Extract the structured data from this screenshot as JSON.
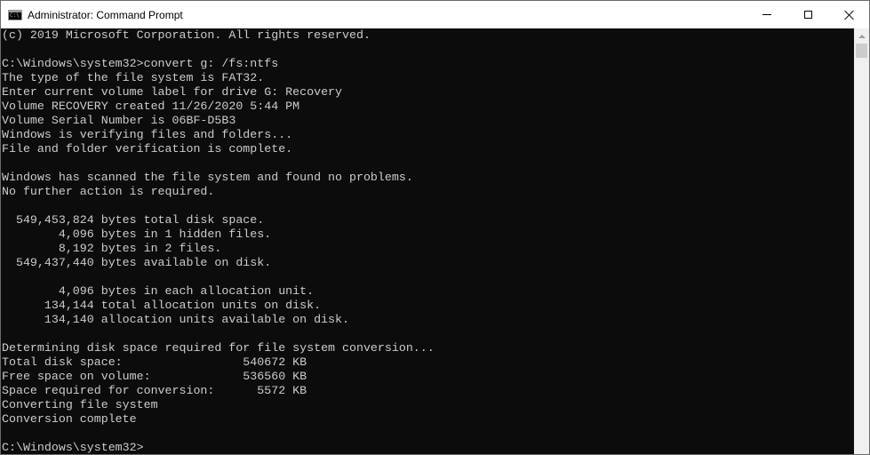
{
  "window": {
    "title": "Administrator: Command Prompt",
    "icon_label": "C:\\"
  },
  "console": {
    "lines": [
      "(c) 2019 Microsoft Corporation. All rights reserved.",
      "",
      "C:\\Windows\\system32>convert g: /fs:ntfs",
      "The type of the file system is FAT32.",
      "Enter current volume label for drive G: Recovery",
      "Volume RECOVERY created 11/26/2020 5:44 PM",
      "Volume Serial Number is 06BF-D5B3",
      "Windows is verifying files and folders...",
      "File and folder verification is complete.",
      "",
      "Windows has scanned the file system and found no problems.",
      "No further action is required.",
      "",
      "  549,453,824 bytes total disk space.",
      "        4,096 bytes in 1 hidden files.",
      "        8,192 bytes in 2 files.",
      "  549,437,440 bytes available on disk.",
      "",
      "        4,096 bytes in each allocation unit.",
      "      134,144 total allocation units on disk.",
      "      134,140 allocation units available on disk.",
      "",
      "Determining disk space required for file system conversion...",
      "Total disk space:                 540672 KB",
      "Free space on volume:             536560 KB",
      "Space required for conversion:      5572 KB",
      "Converting file system",
      "Conversion complete",
      "",
      "C:\\Windows\\system32>"
    ]
  },
  "colors": {
    "console_background": "#0c0c0c",
    "console_text": "#cccccc",
    "titlebar_background": "#ffffff"
  }
}
